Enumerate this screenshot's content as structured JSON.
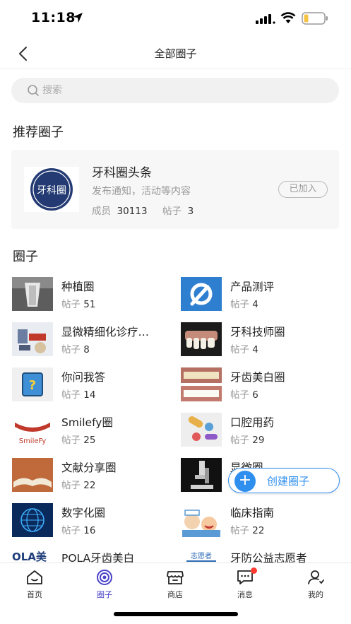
{
  "status_bar": {
    "time": "11:18"
  },
  "nav": {
    "title": "全部圈子"
  },
  "search": {
    "placeholder": "搜索"
  },
  "recommended": {
    "section_title": "推荐圈子",
    "card": {
      "logo_text": "牙科圈",
      "title": "牙科圈头条",
      "description": "发布通知，活动等内容",
      "members_label": "成员",
      "members_count": "30113",
      "posts_label": "帖子",
      "posts_count": "3",
      "status": "已加入"
    }
  },
  "circles": {
    "section_title": "圈子",
    "posts_label": "帖子",
    "items": [
      {
        "name": "种植圈",
        "posts": "51",
        "icon": "dental-xray-thumb"
      },
      {
        "name": "产品测评",
        "posts": "4",
        "icon": "wrench-gear-thumb"
      },
      {
        "name": "显微精细化诊疗…",
        "posts": "8",
        "icon": "microscope-model-thumb"
      },
      {
        "name": "牙科技师圈",
        "posts": "4",
        "icon": "teeth-model-thumb"
      },
      {
        "name": "你问我答",
        "posts": "14",
        "icon": "question-book-thumb"
      },
      {
        "name": "牙齿美白圈",
        "posts": "6",
        "icon": "whitening-thumb"
      },
      {
        "name": "Smilefy圈",
        "posts": "25",
        "icon": "smilefy-logo-thumb",
        "thumb_text": "SmileFy"
      },
      {
        "name": "口腔用药",
        "posts": "29",
        "icon": "pills-thumb"
      },
      {
        "name": "文献分享圈",
        "posts": "22",
        "icon": "book-thumb"
      },
      {
        "name": "显微圈",
        "posts": "",
        "icon": "microscope-thumb"
      },
      {
        "name": "数字化圈",
        "posts": "16",
        "icon": "digital-globe-thumb"
      },
      {
        "name": "临床指南",
        "posts": "22",
        "icon": "dentist-cartoon-thumb"
      },
      {
        "name": "POLA牙齿美白",
        "posts": "",
        "icon": "pola-logo-thumb",
        "thumb_text": "OLA美"
      },
      {
        "name": "牙防公益志愿者",
        "posts": "",
        "icon": "volunteer-thumb",
        "thumb_text": "志愿者"
      }
    ]
  },
  "fab": {
    "label": "创建圈子"
  },
  "tabs": [
    {
      "label": "首页",
      "icon": "home-icon"
    },
    {
      "label": "圈子",
      "icon": "circle-target-icon",
      "active": true
    },
    {
      "label": "商店",
      "icon": "shop-icon"
    },
    {
      "label": "消息",
      "icon": "message-icon",
      "badge": true
    },
    {
      "label": "我的",
      "icon": "profile-icon"
    }
  ],
  "colors": {
    "accent": "#2f8fef",
    "tab_active": "#4a42c9",
    "badge": "#ff3b30",
    "battery": "#f6c344"
  }
}
